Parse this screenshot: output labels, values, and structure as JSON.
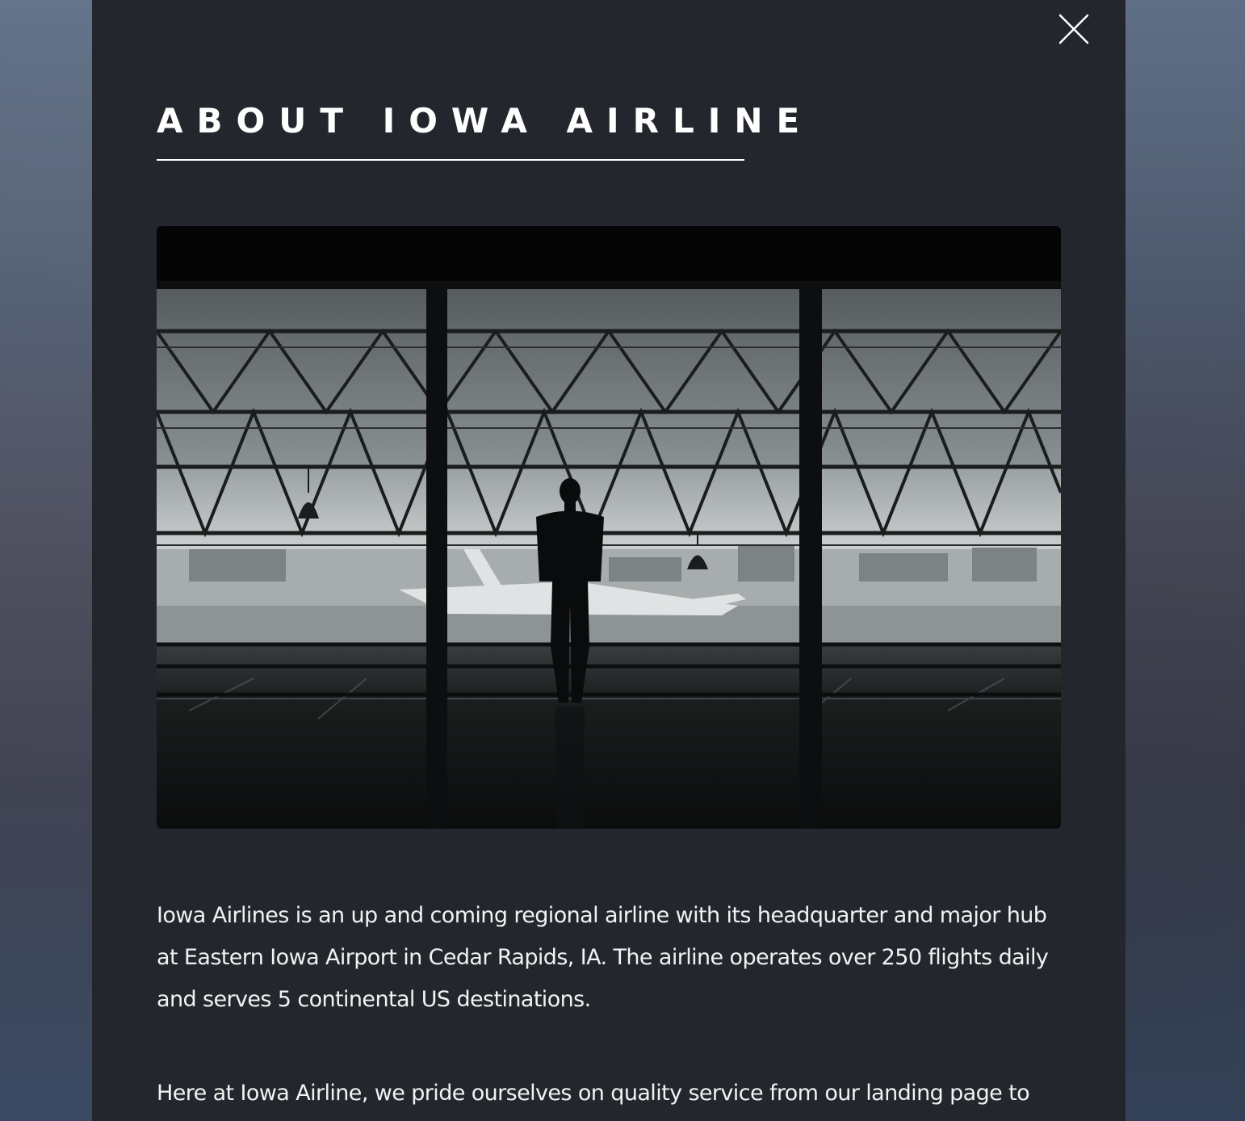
{
  "modal": {
    "title": "ABOUT IOWA AIRLINE",
    "close_icon": "close-x-icon",
    "photo_icon": "airport-terminal-photo",
    "paragraphs": [
      "Iowa Airlines is an up and coming regional airline with its headquarter and major hub at Eastern Iowa Airport in Cedar Rapids, IA. The airline operates over 250 flights daily and serves 5 continental US destinations.",
      "Here at Iowa Airline, we pride ourselves on quality service from our landing page to"
    ]
  },
  "colors": {
    "modal_background": "#23272d",
    "text": "#ffffff"
  }
}
